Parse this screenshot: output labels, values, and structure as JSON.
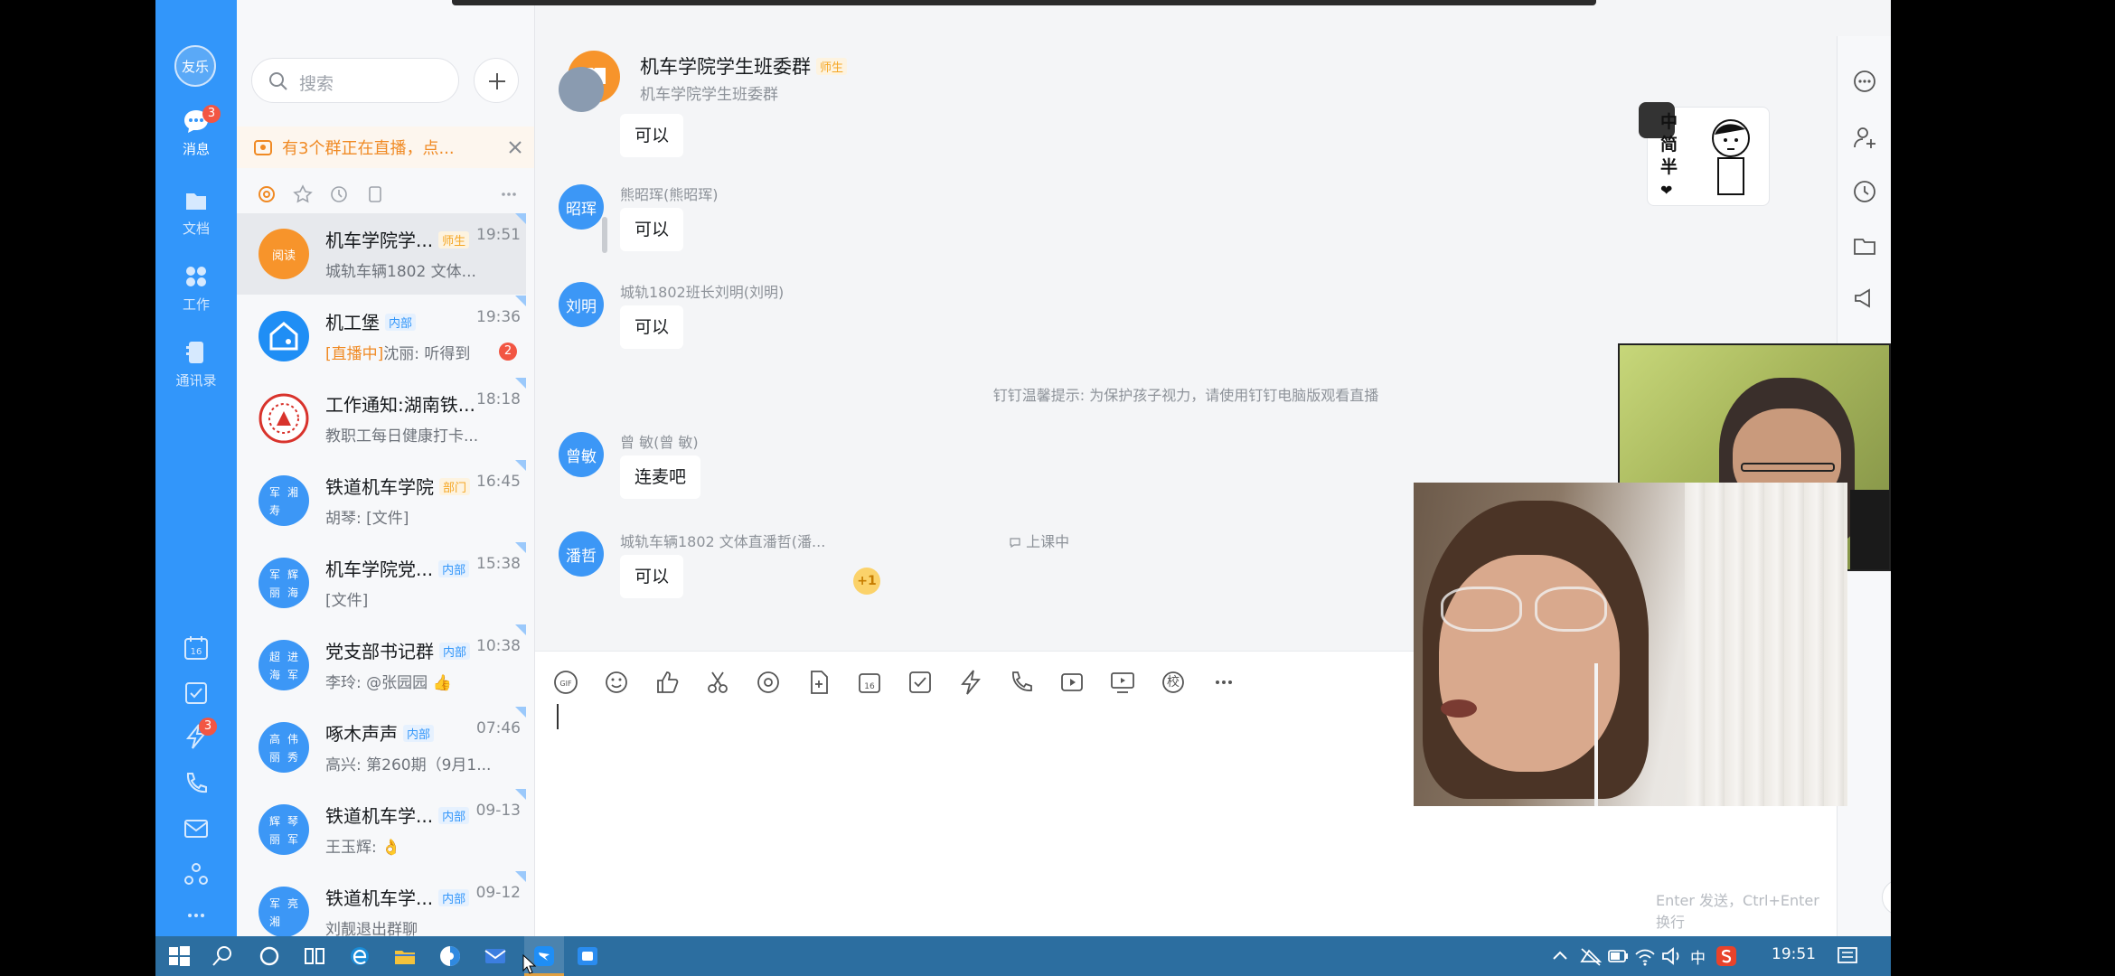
{
  "nav": {
    "avatar_label": "友乐",
    "items": [
      {
        "label": "消息",
        "badge": "3"
      },
      {
        "label": "文档"
      },
      {
        "label": "工作"
      },
      {
        "label": "通讯录"
      }
    ],
    "tool_badge": "3",
    "calendar_day": "16"
  },
  "list": {
    "search_placeholder": "搜索",
    "live_banner": "有3个群正在直播，点...",
    "conversations": [
      {
        "name": "机车学院学...",
        "tag": "师生",
        "tag_color": "orange",
        "time": "19:51",
        "preview": "城轨车辆1802 文体...",
        "avatar_color": "#f7942b",
        "avatar_text": "阅读"
      },
      {
        "name": "机工堡",
        "tag": "内部",
        "tag_color": "blue",
        "time": "19:36",
        "preview_live": "[直播中]",
        "preview": "沈丽: 听得到",
        "badge": "2",
        "avatar_color": "#1f8ef5",
        "avatar_text": ""
      },
      {
        "name": "工作通知:湖南铁...",
        "tag": "",
        "time": "18:18",
        "preview": "教职工每日健康打卡...",
        "avatar_color": "#d8332c",
        "avatar_text": ""
      },
      {
        "name": "铁道机车学院",
        "tag": "部门",
        "tag_color": "orange",
        "time": "16:45",
        "preview": "胡琴: [文件]",
        "avatar_color": "#3c97f6",
        "avatar_text": "军湘寿"
      },
      {
        "name": "机车学院党...",
        "tag": "内部",
        "tag_color": "blue",
        "time": "15:38",
        "preview": "[文件]",
        "avatar_color": "#3c97f6",
        "avatar_text": "军辉丽海"
      },
      {
        "name": "党支部书记群",
        "tag": "内部",
        "tag_color": "blue",
        "time": "10:38",
        "preview": "李玲: @张园园 👍",
        "avatar_color": "#3c97f6",
        "avatar_text": "超进海军"
      },
      {
        "name": "啄木声声",
        "tag": "内部",
        "tag_color": "blue",
        "time": "07:46",
        "preview": "高兴: 第260期（9月1...",
        "avatar_color": "#3c97f6",
        "avatar_text": "高伟丽秀"
      },
      {
        "name": "铁道机车学...",
        "tag": "内部",
        "tag_color": "blue",
        "time": "09-13",
        "preview": "王玉辉: 👌",
        "avatar_color": "#3c97f6",
        "avatar_text": "辉琴丽军"
      },
      {
        "name": "铁道机车学...",
        "tag": "内部",
        "tag_color": "blue",
        "time": "09-12",
        "preview": "刘靓退出群聊",
        "avatar_color": "#3c97f6",
        "avatar_text": "军亮湘"
      }
    ]
  },
  "chat": {
    "title": "机车学院学生班委群",
    "title_tag": "师生",
    "subtitle": "机车学院学生班委群",
    "messages": [
      {
        "avatar": "",
        "sender": "",
        "text": "可以"
      },
      {
        "avatar": "昭珲",
        "sender": "熊昭珲(熊昭珲)",
        "text": "可以"
      },
      {
        "avatar": "刘明",
        "sender": "城轨1802班长刘明(刘明)",
        "text": "可以"
      },
      {
        "avatar": "曾敏",
        "sender": "曾 敏(曾 敏)",
        "text": "连麦吧"
      },
      {
        "avatar": "潘哲",
        "sender": "城轨车辆1802 文体直潘哲(潘...",
        "text": "可以"
      }
    ],
    "system_tip": "钉钉温馨提示: 为保护孩子视力，请使用钉钉电脑版观看直播",
    "live_status": "上课中",
    "plus_one": "+1",
    "sticker_text": [
      "中",
      "简",
      "半"
    ],
    "send_hint": "Enter 发送，Ctrl+Enter 换行",
    "send_label": "发送",
    "calendar_day": "16",
    "school_btn": "校"
  },
  "taskbar": {
    "ime": "中",
    "clock": "19:51"
  }
}
